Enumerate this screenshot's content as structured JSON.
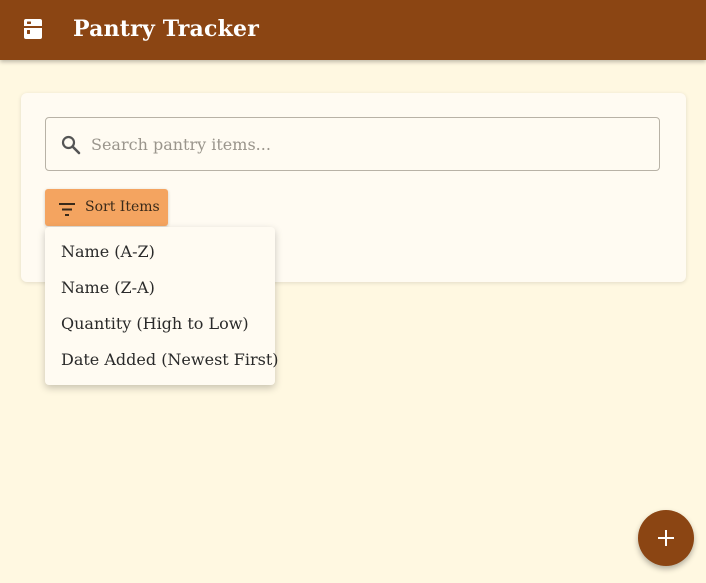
{
  "app_bar": {
    "icon": "pantry-box-icon",
    "title": "Pantry Tracker"
  },
  "search": {
    "icon": "search-icon",
    "placeholder": "Search pantry items...",
    "value": ""
  },
  "sort": {
    "icon": "filter-list-icon",
    "button_label": "Sort Items",
    "menu_items": [
      "Name (A-Z)",
      "Name (Z-A)",
      "Quantity (High to Low)",
      "Date Added (Newest First)"
    ]
  },
  "fab": {
    "icon": "plus-icon"
  },
  "colors": {
    "app_bar": "#8B4513",
    "background": "#FFF8E1",
    "card": "#FFFBF2",
    "sort_button": "#F4A460",
    "fab": "#8B4513"
  }
}
